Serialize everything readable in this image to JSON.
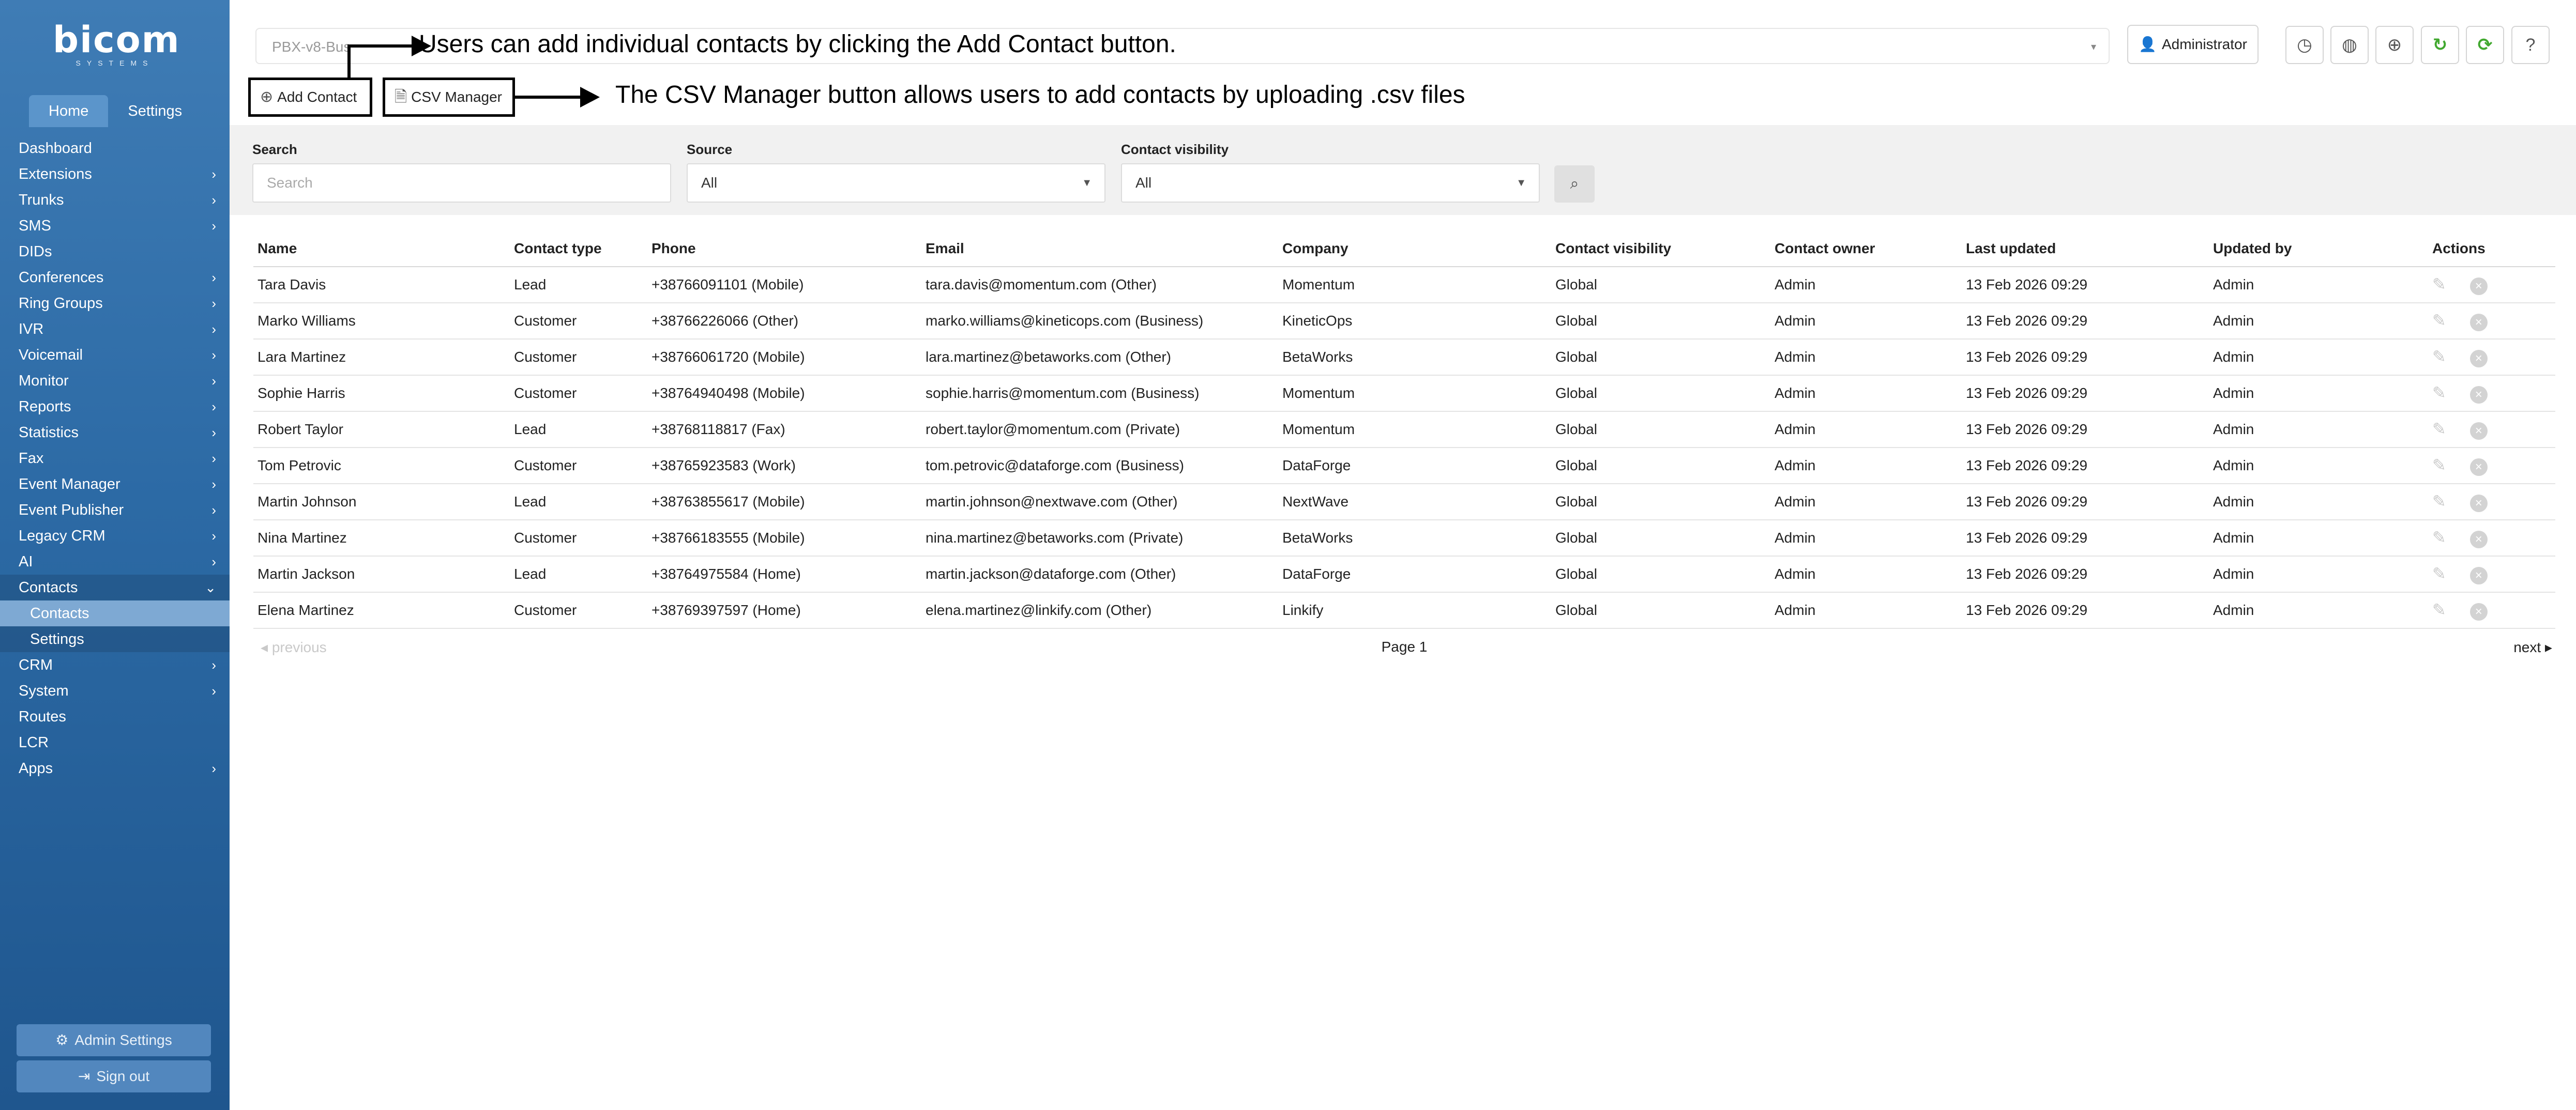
{
  "brand": {
    "name": "bicom",
    "sub": "SYSTEMS"
  },
  "sidebar": {
    "tabs": [
      {
        "label": "Home"
      },
      {
        "label": "Settings"
      }
    ],
    "items": [
      {
        "label": "Dashboard",
        "chevron": ""
      },
      {
        "label": "Extensions",
        "chevron": "›"
      },
      {
        "label": "Trunks",
        "chevron": "›"
      },
      {
        "label": "SMS",
        "chevron": "›"
      },
      {
        "label": "DIDs",
        "chevron": ""
      },
      {
        "label": "Conferences",
        "chevron": "›"
      },
      {
        "label": "Ring Groups",
        "chevron": "›"
      },
      {
        "label": "IVR",
        "chevron": "›"
      },
      {
        "label": "Voicemail",
        "chevron": "›"
      },
      {
        "label": "Monitor",
        "chevron": "›"
      },
      {
        "label": "Reports",
        "chevron": "›"
      },
      {
        "label": "Statistics",
        "chevron": "›"
      },
      {
        "label": "Fax",
        "chevron": "›"
      },
      {
        "label": "Event Manager",
        "chevron": "›"
      },
      {
        "label": "Event Publisher",
        "chevron": "›"
      },
      {
        "label": "Legacy CRM",
        "chevron": "›"
      },
      {
        "label": "AI",
        "chevron": "›"
      },
      {
        "label": "Contacts",
        "chevron": "⌄"
      },
      {
        "label": "Contacts",
        "chevron": ""
      },
      {
        "label": "Settings",
        "chevron": ""
      },
      {
        "label": "CRM",
        "chevron": "›"
      },
      {
        "label": "System",
        "chevron": "›"
      },
      {
        "label": "Routes",
        "chevron": ""
      },
      {
        "label": "LCR",
        "chevron": ""
      },
      {
        "label": "Apps",
        "chevron": "›"
      }
    ],
    "admin_settings": "Admin Settings",
    "sign_out": "Sign out"
  },
  "header": {
    "pbx_select": "PBX-v8-Bus",
    "user": "Administrator"
  },
  "toolbar": {
    "add_contact": "Add Contact",
    "csv_manager": "CSV Manager"
  },
  "annotations": {
    "add_contact_note": "Users can add individual contacts by clicking the Add Contact button.",
    "csv_manager_note": "The CSV Manager button allows users to add contacts by uploading .csv files"
  },
  "filters": {
    "search_label": "Search",
    "search_placeholder": "Search",
    "source_label": "Source",
    "source_value": "All",
    "visibility_label": "Contact visibility",
    "visibility_value": "All"
  },
  "table": {
    "headers": [
      "Name",
      "Contact type",
      "Phone",
      "Email",
      "Company",
      "Contact visibility",
      "Contact owner",
      "Last updated",
      "Updated by",
      "Actions"
    ],
    "rows": [
      [
        "Tara Davis",
        "Lead",
        "+38766091101 (Mobile)",
        "tara.davis@momentum.com (Other)",
        "Momentum",
        "Global",
        "Admin",
        "13 Feb 2026 09:29",
        "Admin"
      ],
      [
        "Marko Williams",
        "Customer",
        "+38766226066 (Other)",
        "marko.williams@kineticops.com (Business)",
        "KineticOps",
        "Global",
        "Admin",
        "13 Feb 2026 09:29",
        "Admin"
      ],
      [
        "Lara Martinez",
        "Customer",
        "+38766061720 (Mobile)",
        "lara.martinez@betaworks.com (Other)",
        "BetaWorks",
        "Global",
        "Admin",
        "13 Feb 2026 09:29",
        "Admin"
      ],
      [
        "Sophie Harris",
        "Customer",
        "+38764940498 (Mobile)",
        "sophie.harris@momentum.com (Business)",
        "Momentum",
        "Global",
        "Admin",
        "13 Feb 2026 09:29",
        "Admin"
      ],
      [
        "Robert Taylor",
        "Lead",
        "+38768118817 (Fax)",
        "robert.taylor@momentum.com (Private)",
        "Momentum",
        "Global",
        "Admin",
        "13 Feb 2026 09:29",
        "Admin"
      ],
      [
        "Tom Petrovic",
        "Customer",
        "+38765923583 (Work)",
        "tom.petrovic@dataforge.com (Business)",
        "DataForge",
        "Global",
        "Admin",
        "13 Feb 2026 09:29",
        "Admin"
      ],
      [
        "Martin Johnson",
        "Lead",
        "+38763855617 (Mobile)",
        "martin.johnson@nextwave.com (Other)",
        "NextWave",
        "Global",
        "Admin",
        "13 Feb 2026 09:29",
        "Admin"
      ],
      [
        "Nina Martinez",
        "Customer",
        "+38766183555 (Mobile)",
        "nina.martinez@betaworks.com (Private)",
        "BetaWorks",
        "Global",
        "Admin",
        "13 Feb 2026 09:29",
        "Admin"
      ],
      [
        "Martin Jackson",
        "Lead",
        "+38764975584 (Home)",
        "martin.jackson@dataforge.com (Other)",
        "DataForge",
        "Global",
        "Admin",
        "13 Feb 2026 09:29",
        "Admin"
      ],
      [
        "Elena Martinez",
        "Customer",
        "+38769397597 (Home)",
        "elena.martinez@linkify.com (Other)",
        "Linkify",
        "Global",
        "Admin",
        "13 Feb 2026 09:29",
        "Admin"
      ]
    ]
  },
  "pagination": {
    "previous": "previous",
    "page": "Page 1",
    "next": "next"
  },
  "icons": {
    "plus": "plus-circle-icon",
    "file": "file-icon",
    "user": "user-icon",
    "clock": "clock-icon",
    "globe": "globe-icon",
    "refresh": "refresh-icon",
    "help": "help-icon",
    "search": "search-icon",
    "edit": "edit-icon",
    "delete": "delete-icon",
    "cogs": "cogs-icon",
    "sign-out": "sign-out-icon"
  },
  "colors": {
    "sidebar": "#2c6aa5",
    "active_tab": "#5b95cb",
    "refresh_green": "#41a82f"
  }
}
